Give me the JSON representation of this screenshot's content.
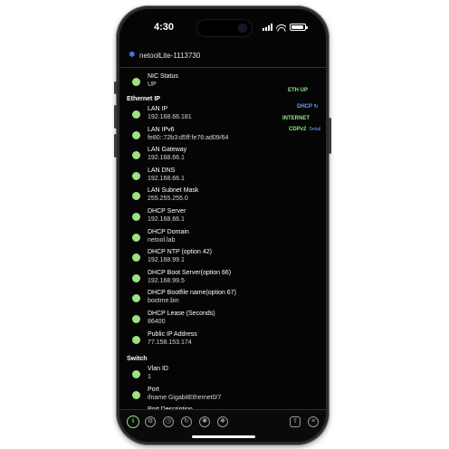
{
  "status_bar": {
    "time": "4:30",
    "battery_fraction": 0.9,
    "signal_bars": 4
  },
  "header": {
    "device_name": "netoolLite-1113730",
    "bt_icon": "bluetooth-icon"
  },
  "tags": {
    "eth": "ETH UP",
    "dhcp": "DHCP",
    "dhcp_icon": "refresh-icon",
    "internet": "INTERNET",
    "cdp": "CDPv2",
    "cdp_detail": "Detail"
  },
  "rows_top": [
    {
      "label": "NIC Status",
      "value": "UP"
    }
  ],
  "sections": {
    "ethernet_ip": "Ethernet IP",
    "switch": "Switch"
  },
  "ethernet_rows": [
    {
      "label": "LAN IP",
      "value": "192.168.66.181"
    },
    {
      "label": "LAN IPv6",
      "value": "fe80::72b3:d5ff:fe76:ad09/64"
    },
    {
      "label": "LAN Gateway",
      "value": "192.168.66.1"
    },
    {
      "label": "LAN DNS",
      "value": "192.168.66.1"
    },
    {
      "label": "LAN Subnet Mask",
      "value": "255.255.255.0"
    },
    {
      "label": "DHCP Server",
      "value": "192.168.66.1"
    },
    {
      "label": "DHCP Domain",
      "value": "netool.lab"
    },
    {
      "label": "DHCP NTP (option 42)",
      "value": "192.168.99.1"
    },
    {
      "label": "DHCP Boot Server(option 66)",
      "value": "192.168.99.5"
    },
    {
      "label": "DHCP Bootfile name(option 67)",
      "value": "bootme.bin"
    },
    {
      "label": "DHCP Lease (Seconds)",
      "value": "86400"
    },
    {
      "label": "Public IP Address",
      "value": "77.158.153.174"
    }
  ],
  "switch_rows": [
    {
      "label": "Vlan ID",
      "value": "1"
    },
    {
      "label": "Port",
      "value": "ifname GigabitEthernet0/7"
    },
    {
      "label": "Port Description",
      "value": ""
    }
  ],
  "tabbar": [
    {
      "icon": "info-icon",
      "glyph": "i"
    },
    {
      "icon": "gear-icon",
      "glyph": "⚙"
    },
    {
      "icon": "clock-icon",
      "glyph": "◷"
    },
    {
      "icon": "refresh-icon",
      "glyph": "↻"
    },
    {
      "icon": "sun-icon",
      "glyph": "✺"
    },
    {
      "icon": "tag-icon",
      "glyph": "❖"
    },
    {
      "icon": "share-icon",
      "glyph": "⇧"
    },
    {
      "icon": "menu-icon",
      "glyph": "≡"
    }
  ]
}
